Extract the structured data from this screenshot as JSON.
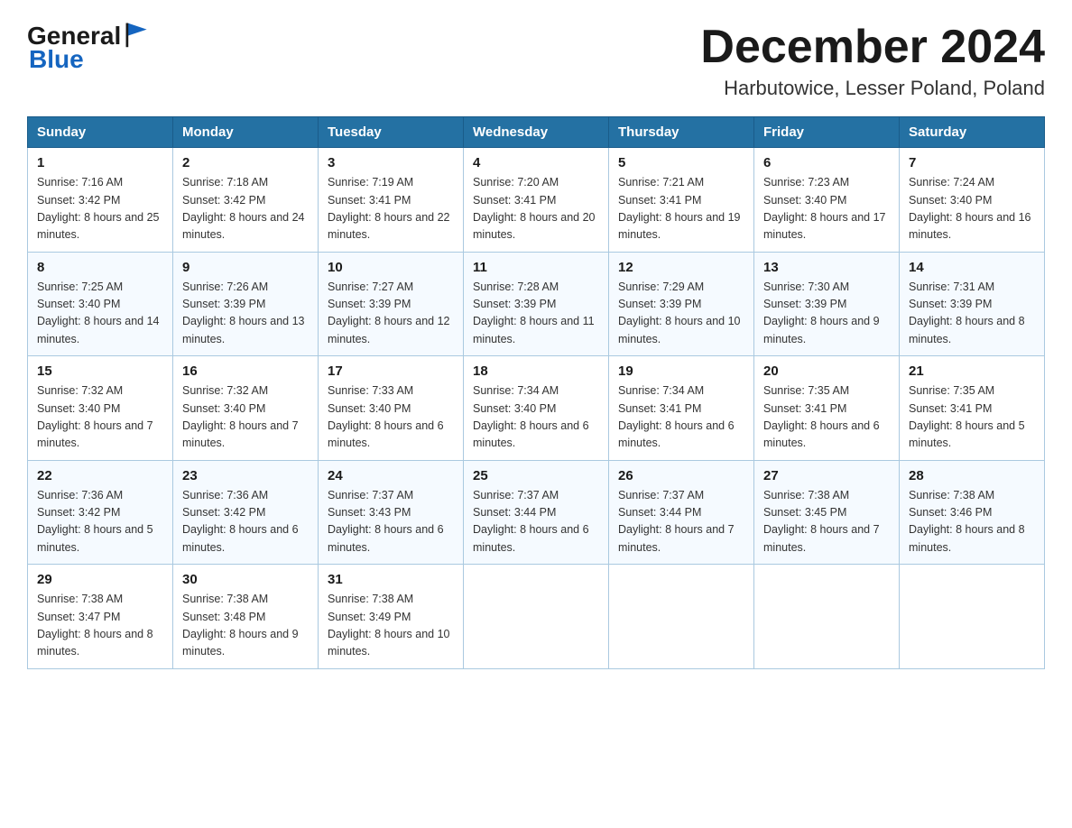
{
  "header": {
    "logo": {
      "text_general": "General",
      "text_blue": "Blue",
      "icon_alt": "General Blue logo flag"
    },
    "title": "December 2024",
    "location": "Harbutowice, Lesser Poland, Poland"
  },
  "calendar": {
    "days_of_week": [
      "Sunday",
      "Monday",
      "Tuesday",
      "Wednesday",
      "Thursday",
      "Friday",
      "Saturday"
    ],
    "weeks": [
      [
        {
          "day": "1",
          "sunrise": "Sunrise: 7:16 AM",
          "sunset": "Sunset: 3:42 PM",
          "daylight": "Daylight: 8 hours and 25 minutes."
        },
        {
          "day": "2",
          "sunrise": "Sunrise: 7:18 AM",
          "sunset": "Sunset: 3:42 PM",
          "daylight": "Daylight: 8 hours and 24 minutes."
        },
        {
          "day": "3",
          "sunrise": "Sunrise: 7:19 AM",
          "sunset": "Sunset: 3:41 PM",
          "daylight": "Daylight: 8 hours and 22 minutes."
        },
        {
          "day": "4",
          "sunrise": "Sunrise: 7:20 AM",
          "sunset": "Sunset: 3:41 PM",
          "daylight": "Daylight: 8 hours and 20 minutes."
        },
        {
          "day": "5",
          "sunrise": "Sunrise: 7:21 AM",
          "sunset": "Sunset: 3:41 PM",
          "daylight": "Daylight: 8 hours and 19 minutes."
        },
        {
          "day": "6",
          "sunrise": "Sunrise: 7:23 AM",
          "sunset": "Sunset: 3:40 PM",
          "daylight": "Daylight: 8 hours and 17 minutes."
        },
        {
          "day": "7",
          "sunrise": "Sunrise: 7:24 AM",
          "sunset": "Sunset: 3:40 PM",
          "daylight": "Daylight: 8 hours and 16 minutes."
        }
      ],
      [
        {
          "day": "8",
          "sunrise": "Sunrise: 7:25 AM",
          "sunset": "Sunset: 3:40 PM",
          "daylight": "Daylight: 8 hours and 14 minutes."
        },
        {
          "day": "9",
          "sunrise": "Sunrise: 7:26 AM",
          "sunset": "Sunset: 3:39 PM",
          "daylight": "Daylight: 8 hours and 13 minutes."
        },
        {
          "day": "10",
          "sunrise": "Sunrise: 7:27 AM",
          "sunset": "Sunset: 3:39 PM",
          "daylight": "Daylight: 8 hours and 12 minutes."
        },
        {
          "day": "11",
          "sunrise": "Sunrise: 7:28 AM",
          "sunset": "Sunset: 3:39 PM",
          "daylight": "Daylight: 8 hours and 11 minutes."
        },
        {
          "day": "12",
          "sunrise": "Sunrise: 7:29 AM",
          "sunset": "Sunset: 3:39 PM",
          "daylight": "Daylight: 8 hours and 10 minutes."
        },
        {
          "day": "13",
          "sunrise": "Sunrise: 7:30 AM",
          "sunset": "Sunset: 3:39 PM",
          "daylight": "Daylight: 8 hours and 9 minutes."
        },
        {
          "day": "14",
          "sunrise": "Sunrise: 7:31 AM",
          "sunset": "Sunset: 3:39 PM",
          "daylight": "Daylight: 8 hours and 8 minutes."
        }
      ],
      [
        {
          "day": "15",
          "sunrise": "Sunrise: 7:32 AM",
          "sunset": "Sunset: 3:40 PM",
          "daylight": "Daylight: 8 hours and 7 minutes."
        },
        {
          "day": "16",
          "sunrise": "Sunrise: 7:32 AM",
          "sunset": "Sunset: 3:40 PM",
          "daylight": "Daylight: 8 hours and 7 minutes."
        },
        {
          "day": "17",
          "sunrise": "Sunrise: 7:33 AM",
          "sunset": "Sunset: 3:40 PM",
          "daylight": "Daylight: 8 hours and 6 minutes."
        },
        {
          "day": "18",
          "sunrise": "Sunrise: 7:34 AM",
          "sunset": "Sunset: 3:40 PM",
          "daylight": "Daylight: 8 hours and 6 minutes."
        },
        {
          "day": "19",
          "sunrise": "Sunrise: 7:34 AM",
          "sunset": "Sunset: 3:41 PM",
          "daylight": "Daylight: 8 hours and 6 minutes."
        },
        {
          "day": "20",
          "sunrise": "Sunrise: 7:35 AM",
          "sunset": "Sunset: 3:41 PM",
          "daylight": "Daylight: 8 hours and 6 minutes."
        },
        {
          "day": "21",
          "sunrise": "Sunrise: 7:35 AM",
          "sunset": "Sunset: 3:41 PM",
          "daylight": "Daylight: 8 hours and 5 minutes."
        }
      ],
      [
        {
          "day": "22",
          "sunrise": "Sunrise: 7:36 AM",
          "sunset": "Sunset: 3:42 PM",
          "daylight": "Daylight: 8 hours and 5 minutes."
        },
        {
          "day": "23",
          "sunrise": "Sunrise: 7:36 AM",
          "sunset": "Sunset: 3:42 PM",
          "daylight": "Daylight: 8 hours and 6 minutes."
        },
        {
          "day": "24",
          "sunrise": "Sunrise: 7:37 AM",
          "sunset": "Sunset: 3:43 PM",
          "daylight": "Daylight: 8 hours and 6 minutes."
        },
        {
          "day": "25",
          "sunrise": "Sunrise: 7:37 AM",
          "sunset": "Sunset: 3:44 PM",
          "daylight": "Daylight: 8 hours and 6 minutes."
        },
        {
          "day": "26",
          "sunrise": "Sunrise: 7:37 AM",
          "sunset": "Sunset: 3:44 PM",
          "daylight": "Daylight: 8 hours and 7 minutes."
        },
        {
          "day": "27",
          "sunrise": "Sunrise: 7:38 AM",
          "sunset": "Sunset: 3:45 PM",
          "daylight": "Daylight: 8 hours and 7 minutes."
        },
        {
          "day": "28",
          "sunrise": "Sunrise: 7:38 AM",
          "sunset": "Sunset: 3:46 PM",
          "daylight": "Daylight: 8 hours and 8 minutes."
        }
      ],
      [
        {
          "day": "29",
          "sunrise": "Sunrise: 7:38 AM",
          "sunset": "Sunset: 3:47 PM",
          "daylight": "Daylight: 8 hours and 8 minutes."
        },
        {
          "day": "30",
          "sunrise": "Sunrise: 7:38 AM",
          "sunset": "Sunset: 3:48 PM",
          "daylight": "Daylight: 8 hours and 9 minutes."
        },
        {
          "day": "31",
          "sunrise": "Sunrise: 7:38 AM",
          "sunset": "Sunset: 3:49 PM",
          "daylight": "Daylight: 8 hours and 10 minutes."
        },
        null,
        null,
        null,
        null
      ]
    ]
  }
}
